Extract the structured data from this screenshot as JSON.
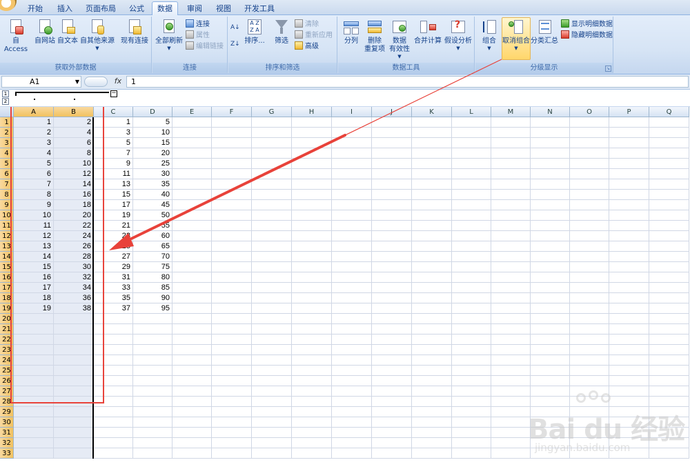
{
  "ribbon": {
    "tabs": [
      {
        "label": "开始",
        "active": false
      },
      {
        "label": "插入",
        "active": false
      },
      {
        "label": "页面布局",
        "active": false
      },
      {
        "label": "公式",
        "active": false
      },
      {
        "label": "数据",
        "active": true
      },
      {
        "label": "审阅",
        "active": false
      },
      {
        "label": "视图",
        "active": false
      },
      {
        "label": "开发工具",
        "active": false
      }
    ],
    "groups": {
      "external": {
        "label": "获取外部数据",
        "access": "自 Access",
        "web": "自网站",
        "text": "自文本",
        "other": "自其他来源",
        "existing": "现有连接"
      },
      "connections": {
        "label": "连接",
        "refresh_all": "全部刷新",
        "connections": "连接",
        "properties": "属性",
        "edit_links": "编辑链接"
      },
      "sort_filter": {
        "label": "排序和筛选",
        "sort": "排序...",
        "filter": "筛选",
        "clear": "清除",
        "reapply": "重新应用",
        "advanced": "高级"
      },
      "data_tools": {
        "label": "数据工具",
        "text_to_columns": "分列",
        "remove_duplicates": "删除\n重复项",
        "data_validation": "数据\n有效性",
        "consolidate": "合并计算",
        "what_if": "假设分析"
      },
      "outline": {
        "label": "分级显示",
        "group": "组合",
        "ungroup": "取消组合",
        "subtotal": "分类汇总",
        "show_detail": "显示明细数据",
        "hide_detail": "隐藏明细数据"
      }
    }
  },
  "formula_bar": {
    "name_box": "A1",
    "fx": "fx",
    "content": "1"
  },
  "outline": {
    "levels": [
      "1",
      "2"
    ],
    "collapse": "−"
  },
  "sheet": {
    "columns": [
      "A",
      "B",
      "C",
      "D",
      "E",
      "F",
      "G",
      "H",
      "I",
      "J",
      "K",
      "L",
      "M",
      "N",
      "O",
      "P",
      "Q"
    ],
    "selected_columns": [
      "A",
      "B"
    ],
    "row_numbers": [
      "1",
      "2",
      "3",
      "4",
      "5",
      "6",
      "7",
      "8",
      "9",
      "10",
      "11",
      "12",
      "13",
      "14",
      "15",
      "16",
      "17",
      "18",
      "19",
      "20",
      "21",
      "22",
      "23",
      "24",
      "25",
      "26",
      "27",
      "28",
      "29",
      "30",
      "31",
      "32",
      "33"
    ],
    "rows": [
      [
        "1",
        "2",
        "1",
        "5"
      ],
      [
        "2",
        "4",
        "3",
        "10"
      ],
      [
        "3",
        "6",
        "5",
        "15"
      ],
      [
        "4",
        "8",
        "7",
        "20"
      ],
      [
        "5",
        "10",
        "9",
        "25"
      ],
      [
        "6",
        "12",
        "11",
        "30"
      ],
      [
        "7",
        "14",
        "13",
        "35"
      ],
      [
        "8",
        "16",
        "15",
        "40"
      ],
      [
        "9",
        "18",
        "17",
        "45"
      ],
      [
        "10",
        "20",
        "19",
        "50"
      ],
      [
        "11",
        "22",
        "21",
        "55"
      ],
      [
        "12",
        "24",
        "23",
        "60"
      ],
      [
        "13",
        "26",
        "25",
        "65"
      ],
      [
        "14",
        "28",
        "27",
        "70"
      ],
      [
        "15",
        "30",
        "29",
        "75"
      ],
      [
        "16",
        "32",
        "31",
        "80"
      ],
      [
        "17",
        "34",
        "33",
        "85"
      ],
      [
        "18",
        "36",
        "35",
        "90"
      ],
      [
        "19",
        "38",
        "37",
        "95"
      ]
    ]
  },
  "annotation": {
    "box_color": "#e8423a",
    "arrow_color": "#e8423a"
  },
  "watermark": {
    "logo": "Bai du 经验",
    "url": "jingyan.baidu.com"
  }
}
